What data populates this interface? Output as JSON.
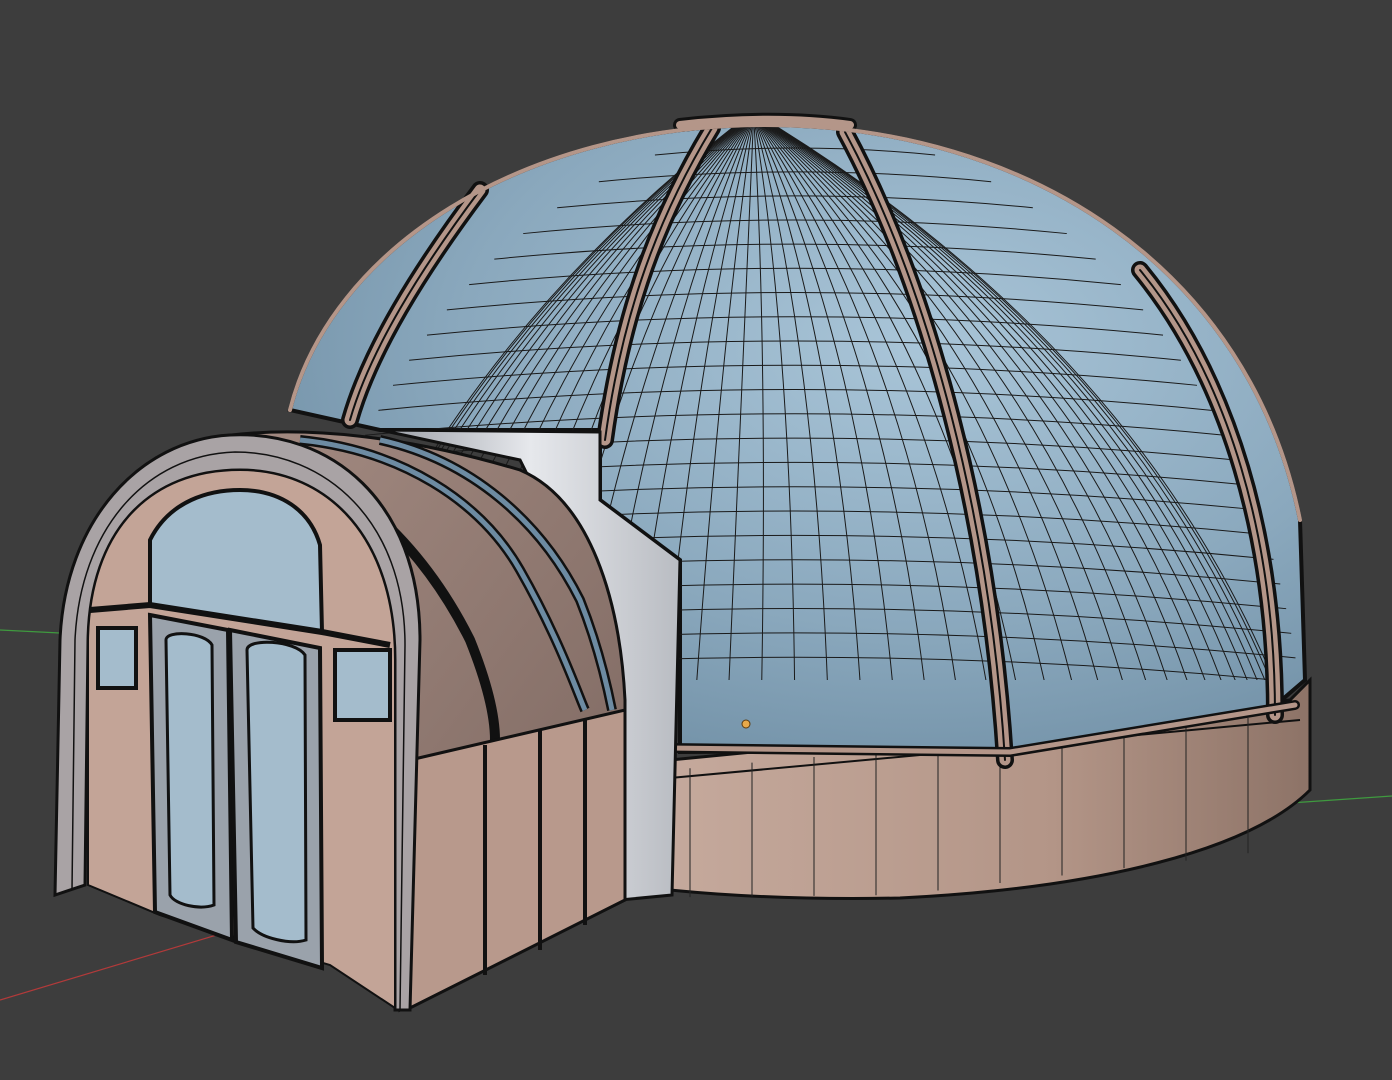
{
  "viewport": {
    "background": "#3d3d3d",
    "x_axis_color": "#b23a3a",
    "y_axis_color": "#3f9a3f",
    "wire_color": "#111111",
    "glass_color": "#8fb0c6",
    "frame_color": "#b49689",
    "wall_color": "#c0c3c8",
    "origin_marker_color": "#e8a94a"
  },
  "model": {
    "parts": [
      "glass-dome",
      "dome-ribs",
      "base-ring",
      "entrance-tunnel",
      "double-door"
    ]
  }
}
